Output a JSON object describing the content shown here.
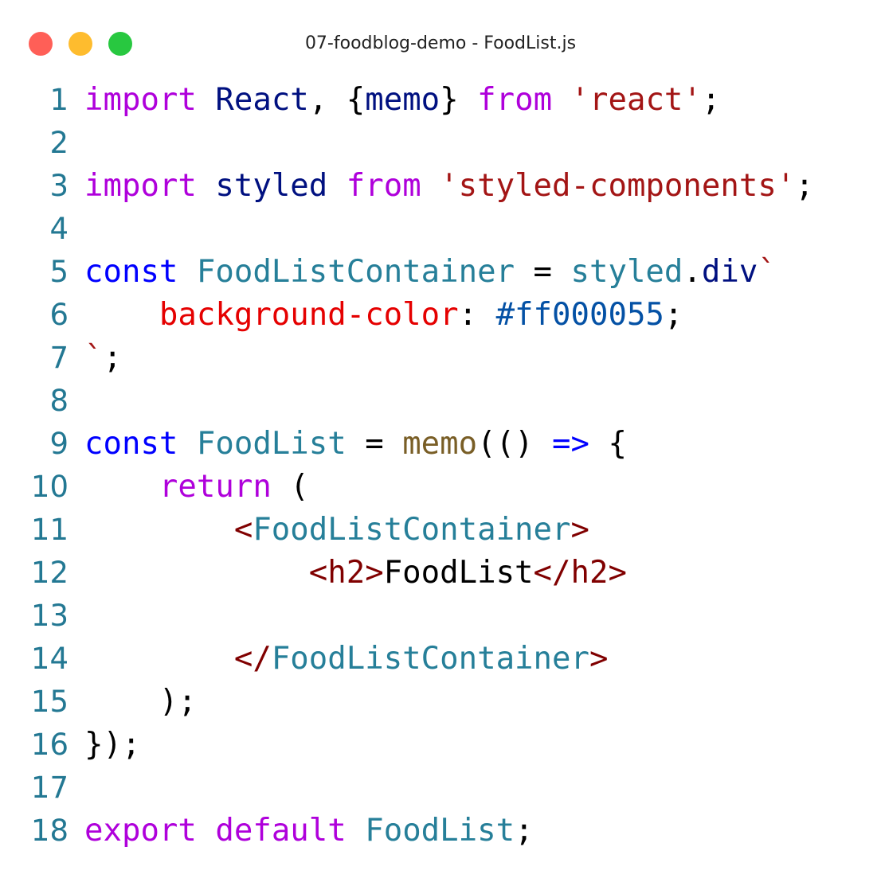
{
  "window": {
    "title": "07-foodblog-demo - FoodList.js",
    "controls": [
      {
        "name": "close-button",
        "color": "#ff5f57"
      },
      {
        "name": "minimize-button",
        "color": "#febc2e"
      },
      {
        "name": "zoom-button",
        "color": "#28c840"
      }
    ]
  },
  "colors": {
    "keyword_purple": "#af00db",
    "keyword_blue": "#0000ff",
    "identifier_navy": "#001080",
    "type_teal": "#267f99",
    "string_red": "#a31515",
    "css_property": "#e50000",
    "css_value": "#0451a5",
    "function_name": "#795e26",
    "tag_bracket": "#800000",
    "plain": "#000000",
    "line_number": "#237893"
  },
  "code": {
    "lines": [
      {
        "n": "1",
        "tokens": [
          {
            "t": "import",
            "c": "#af00db"
          },
          {
            "t": " ",
            "c": "#000000"
          },
          {
            "t": "React",
            "c": "#001080"
          },
          {
            "t": ", {",
            "c": "#000000"
          },
          {
            "t": "memo",
            "c": "#001080"
          },
          {
            "t": "} ",
            "c": "#000000"
          },
          {
            "t": "from",
            "c": "#af00db"
          },
          {
            "t": " ",
            "c": "#000000"
          },
          {
            "t": "'react'",
            "c": "#a31515"
          },
          {
            "t": ";",
            "c": "#000000"
          }
        ]
      },
      {
        "n": "2",
        "tokens": []
      },
      {
        "n": "3",
        "tokens": [
          {
            "t": "import",
            "c": "#af00db"
          },
          {
            "t": " ",
            "c": "#000000"
          },
          {
            "t": "styled",
            "c": "#001080"
          },
          {
            "t": " ",
            "c": "#000000"
          },
          {
            "t": "from",
            "c": "#af00db"
          },
          {
            "t": " ",
            "c": "#000000"
          },
          {
            "t": "'styled-components'",
            "c": "#a31515"
          },
          {
            "t": ";",
            "c": "#000000"
          }
        ]
      },
      {
        "n": "4",
        "tokens": []
      },
      {
        "n": "5",
        "tokens": [
          {
            "t": "const",
            "c": "#0000ff"
          },
          {
            "t": " ",
            "c": "#000000"
          },
          {
            "t": "FoodListContainer",
            "c": "#267f99"
          },
          {
            "t": " = ",
            "c": "#000000"
          },
          {
            "t": "styled",
            "c": "#267f99"
          },
          {
            "t": ".",
            "c": "#000000"
          },
          {
            "t": "div",
            "c": "#001080"
          },
          {
            "t": "`",
            "c": "#a31515"
          }
        ]
      },
      {
        "n": "6",
        "tokens": [
          {
            "t": "    ",
            "c": "#000000"
          },
          {
            "t": "background-color",
            "c": "#e50000"
          },
          {
            "t": ": ",
            "c": "#000000"
          },
          {
            "t": "#ff000055",
            "c": "#0451a5"
          },
          {
            "t": ";",
            "c": "#000000"
          }
        ]
      },
      {
        "n": "7",
        "tokens": [
          {
            "t": "`",
            "c": "#a31515"
          },
          {
            "t": ";",
            "c": "#000000"
          }
        ]
      },
      {
        "n": "8",
        "tokens": []
      },
      {
        "n": "9",
        "tokens": [
          {
            "t": "const",
            "c": "#0000ff"
          },
          {
            "t": " ",
            "c": "#000000"
          },
          {
            "t": "FoodList",
            "c": "#267f99"
          },
          {
            "t": " = ",
            "c": "#000000"
          },
          {
            "t": "memo",
            "c": "#795e26"
          },
          {
            "t": "(() ",
            "c": "#000000"
          },
          {
            "t": "=>",
            "c": "#0000ff"
          },
          {
            "t": " {",
            "c": "#000000"
          }
        ]
      },
      {
        "n": "10",
        "tokens": [
          {
            "t": "    ",
            "c": "#000000"
          },
          {
            "t": "return",
            "c": "#af00db"
          },
          {
            "t": " (",
            "c": "#000000"
          }
        ]
      },
      {
        "n": "11",
        "tokens": [
          {
            "t": "        ",
            "c": "#000000"
          },
          {
            "t": "<",
            "c": "#800000"
          },
          {
            "t": "FoodListContainer",
            "c": "#267f99"
          },
          {
            "t": ">",
            "c": "#800000"
          }
        ]
      },
      {
        "n": "12",
        "tokens": [
          {
            "t": "            ",
            "c": "#000000"
          },
          {
            "t": "<h2>",
            "c": "#800000"
          },
          {
            "t": "FoodList",
            "c": "#000000"
          },
          {
            "t": "</h2>",
            "c": "#800000"
          }
        ]
      },
      {
        "n": "13",
        "tokens": []
      },
      {
        "n": "14",
        "tokens": [
          {
            "t": "        ",
            "c": "#000000"
          },
          {
            "t": "</",
            "c": "#800000"
          },
          {
            "t": "FoodListContainer",
            "c": "#267f99"
          },
          {
            "t": ">",
            "c": "#800000"
          }
        ]
      },
      {
        "n": "15",
        "tokens": [
          {
            "t": "    );",
            "c": "#000000"
          }
        ]
      },
      {
        "n": "16",
        "tokens": [
          {
            "t": "});",
            "c": "#000000"
          }
        ]
      },
      {
        "n": "17",
        "tokens": []
      },
      {
        "n": "18",
        "tokens": [
          {
            "t": "export",
            "c": "#af00db"
          },
          {
            "t": " ",
            "c": "#000000"
          },
          {
            "t": "default",
            "c": "#af00db"
          },
          {
            "t": " ",
            "c": "#000000"
          },
          {
            "t": "FoodList",
            "c": "#267f99"
          },
          {
            "t": ";",
            "c": "#000000"
          }
        ]
      }
    ]
  }
}
